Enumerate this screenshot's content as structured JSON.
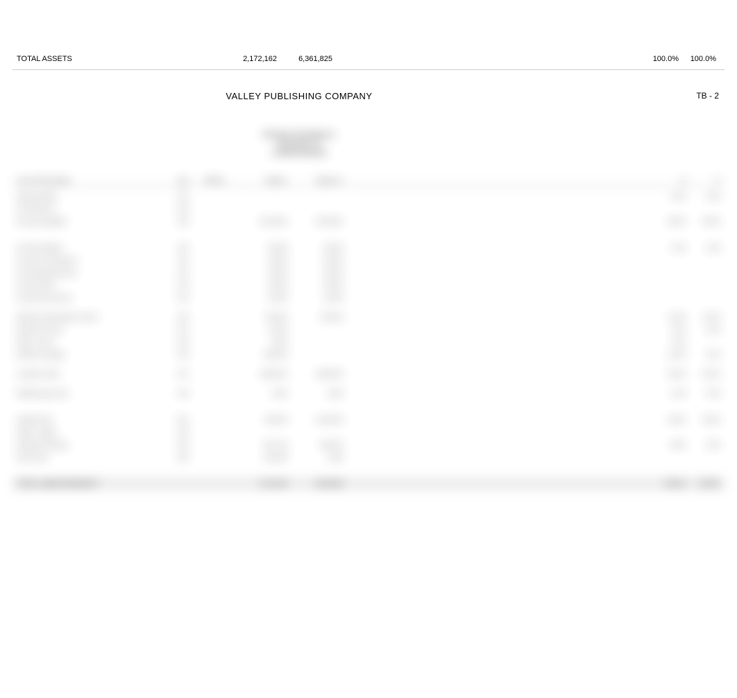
{
  "totals_row": {
    "label": "TOTAL ASSETS",
    "value1": "2,172,162",
    "value2": "6,361,825",
    "pct1": "100.0%",
    "pct2": "100.0%"
  },
  "header": {
    "company_name": "VALLEY PUBLISHING COMPANY",
    "corner_code": "TB - 2",
    "subtitle1": "Working Trial Balance",
    "subtitle2": "December 31",
    "subtitle3": "Liabilities/Equity"
  },
  "blur_table": {
    "columns": [
      "Account Description",
      "Acct",
      "WP Ref",
      "Balance",
      "Balance 2",
      "Adj",
      "Adj 2",
      "Reclass",
      "Reclass 2",
      "Final",
      "Final 2",
      "%",
      "%"
    ],
    "rows": [
      {
        "label": "Notes payable",
        "acct": "301",
        "v1": "",
        "v2": "",
        "p1": "0.0%",
        "p2": "0.0%"
      },
      {
        "label": "A/P discounts",
        "acct": "302",
        "v1": "",
        "v2": ""
      },
      {
        "label": "Accounts payable",
        "acct": "303",
        "v1": "2,919,601",
        "v2": "2,919,601",
        "p1": "45.9%",
        "p2": "45.9%"
      },
      {
        "gap": true
      },
      {
        "label": "Accrued salaries",
        "acct": "310",
        "v1": "25,000",
        "v2": "25,000",
        "p1": "0.4%",
        "p2": "0.4%"
      },
      {
        "label": "Accrued commissions",
        "acct": "311",
        "v1": "30,000",
        "v2": "30,000"
      },
      {
        "label": "Accrued payroll taxes",
        "acct": "312",
        "v1": "25,000",
        "v2": "25,000"
      },
      {
        "label": "Accrued other",
        "acct": "313",
        "v1": "25,000",
        "v2": "25,000"
      },
      {
        "label": "Accrued income tax",
        "acct": "314",
        "v1": "24,400",
        "v2": "24,400",
        "p1": "",
        "p2": ""
      },
      {
        "gap": true,
        "small": true
      },
      {
        "label": "Deferred subscription income",
        "acct": "320",
        "v1": "756,919",
        "v2": "756,919",
        "p1": "11.9%",
        "p2": "11.9%"
      },
      {
        "label": "Deferred income",
        "acct": "321",
        "v1": "12,000",
        "v2": "",
        "p1": "0.2%",
        "p2": "0.2%"
      },
      {
        "label": "Other current",
        "acct": "322",
        "v1": "5,000",
        "v2": "",
        "p1": "0.1%",
        "p2": ""
      },
      {
        "label": "Deferred charges",
        "acct": "323",
        "v1": "800,000",
        "v2": "",
        "p1": "12.6%",
        "p2": "0.0%"
      },
      {
        "gap": true,
        "small": true
      },
      {
        "label": "Long-term debt",
        "acct": "401",
        "v1": "1,880,000",
        "v2": "1,880,000",
        "p1": "29.6%",
        "p2": "29.6%"
      },
      {
        "gap": true,
        "small": true
      },
      {
        "label": "Related party note",
        "acct": "402",
        "v1": "3,000",
        "v2": "3,000",
        "p1": "0.0%",
        "p2": "0.0%"
      },
      {
        "gap": true
      },
      {
        "label": "Capital stock",
        "acct": "501",
        "v1": "200,000",
        "v2": "1,200,000",
        "p1": "18.9%",
        "p2": "18.9%"
      },
      {
        "label": "Paid-in capital",
        "acct": "502",
        "v1": "",
        "v2": ""
      },
      {
        "label": "Retained earnings",
        "acct": "503",
        "v1": "-557,743",
        "v2": "250,000",
        "p1": "-8.8%",
        "p2": "3.9%"
      },
      {
        "label": "Net income",
        "acct": "504",
        "v1": "-532,095",
        "v2": "4,095"
      },
      {
        "gap": true
      },
      {
        "label": "TOTAL LIABILITIES/EQUITY",
        "total": true,
        "v1": "2,172,162",
        "v2": "6,361,825",
        "p1": "100.0%",
        "p2": "100.0%"
      }
    ]
  }
}
